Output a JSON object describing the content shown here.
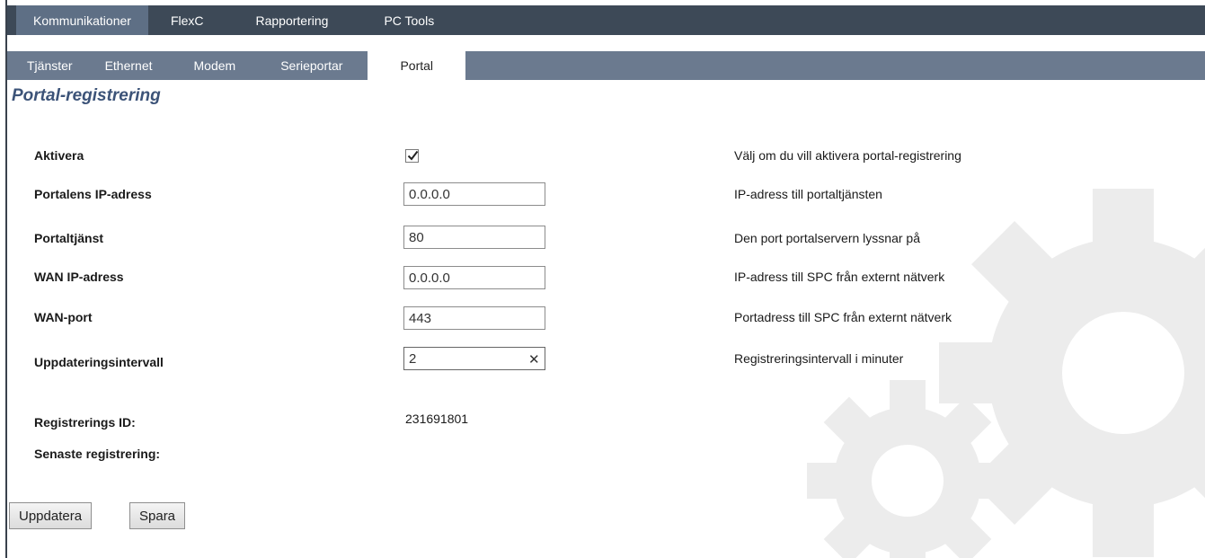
{
  "top_nav": {
    "tabs": [
      {
        "label": "Kommunikationer",
        "active": true
      },
      {
        "label": "FlexC",
        "active": false
      },
      {
        "label": "Rapportering",
        "active": false
      },
      {
        "label": "PC Tools",
        "active": false
      }
    ]
  },
  "sub_nav": {
    "tabs": [
      {
        "label": "Tjänster",
        "active": false
      },
      {
        "label": "Ethernet",
        "active": false
      },
      {
        "label": "Modem",
        "active": false
      },
      {
        "label": "Serieportar",
        "active": false
      },
      {
        "label": "Portal",
        "active": true
      }
    ]
  },
  "page": {
    "title": "Portal-registrering"
  },
  "form": {
    "aktivera": {
      "label": "Aktivera",
      "checked": true,
      "description": "Välj om du vill aktivera portal-registrering"
    },
    "portal_ip": {
      "label": "Portalens IP-adress",
      "value": "0.0.0.0",
      "description": "IP-adress till portaltjänsten"
    },
    "portal_service": {
      "label": "Portaltjänst",
      "value": "80",
      "description": "Den port portalservern lyssnar på"
    },
    "wan_ip": {
      "label": "WAN IP-adress",
      "value": "0.0.0.0",
      "description": "IP-adress till SPC från externt nätverk"
    },
    "wan_port": {
      "label": "WAN-port",
      "value": "443",
      "description": "Portadress till SPC från externt nätverk"
    },
    "update_interval": {
      "label": "Uppdateringsintervall",
      "value": "2",
      "description": "Registreringsintervall i minuter"
    }
  },
  "info": {
    "registration_id": {
      "label": "Registrerings ID:",
      "value": "231691801"
    },
    "last_registration": {
      "label": "Senaste registrering:",
      "value": ""
    }
  },
  "buttons": {
    "update": "Uppdatera",
    "save": "Spara"
  },
  "colors": {
    "top_nav_bg": "#3d4957",
    "sub_nav_bg": "#6b7a8f",
    "title": "#3c5378",
    "gear": "#ececec"
  }
}
